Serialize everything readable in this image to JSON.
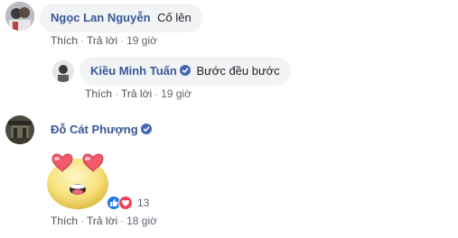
{
  "comments": [
    {
      "author": "Ngọc Lan Nguyễn",
      "text": "Cố lên",
      "verified": false,
      "actions": {
        "like": "Thích",
        "reply": "Trả lời",
        "time": "19 giờ"
      }
    },
    {
      "author": "Kiều Minh Tuấn",
      "text": "Bước đều bước",
      "verified": true,
      "actions": {
        "like": "Thích",
        "reply": "Trả lời",
        "time": "19 giờ"
      }
    },
    {
      "author": "Đỗ Cát Phượng",
      "verified": true,
      "sticker": "heart-eyes-sticker",
      "reactions": {
        "icons": [
          "like-reaction-icon",
          "love-reaction-icon"
        ],
        "count": "13"
      },
      "actions": {
        "like": "Thích",
        "reply": "Trả lời",
        "time": "18 giờ"
      }
    }
  ],
  "colors": {
    "name": "#385898",
    "bubble": "#f2f3f5",
    "verified": "#4267b2",
    "like": "#1877f2",
    "love": "#f33e58"
  }
}
